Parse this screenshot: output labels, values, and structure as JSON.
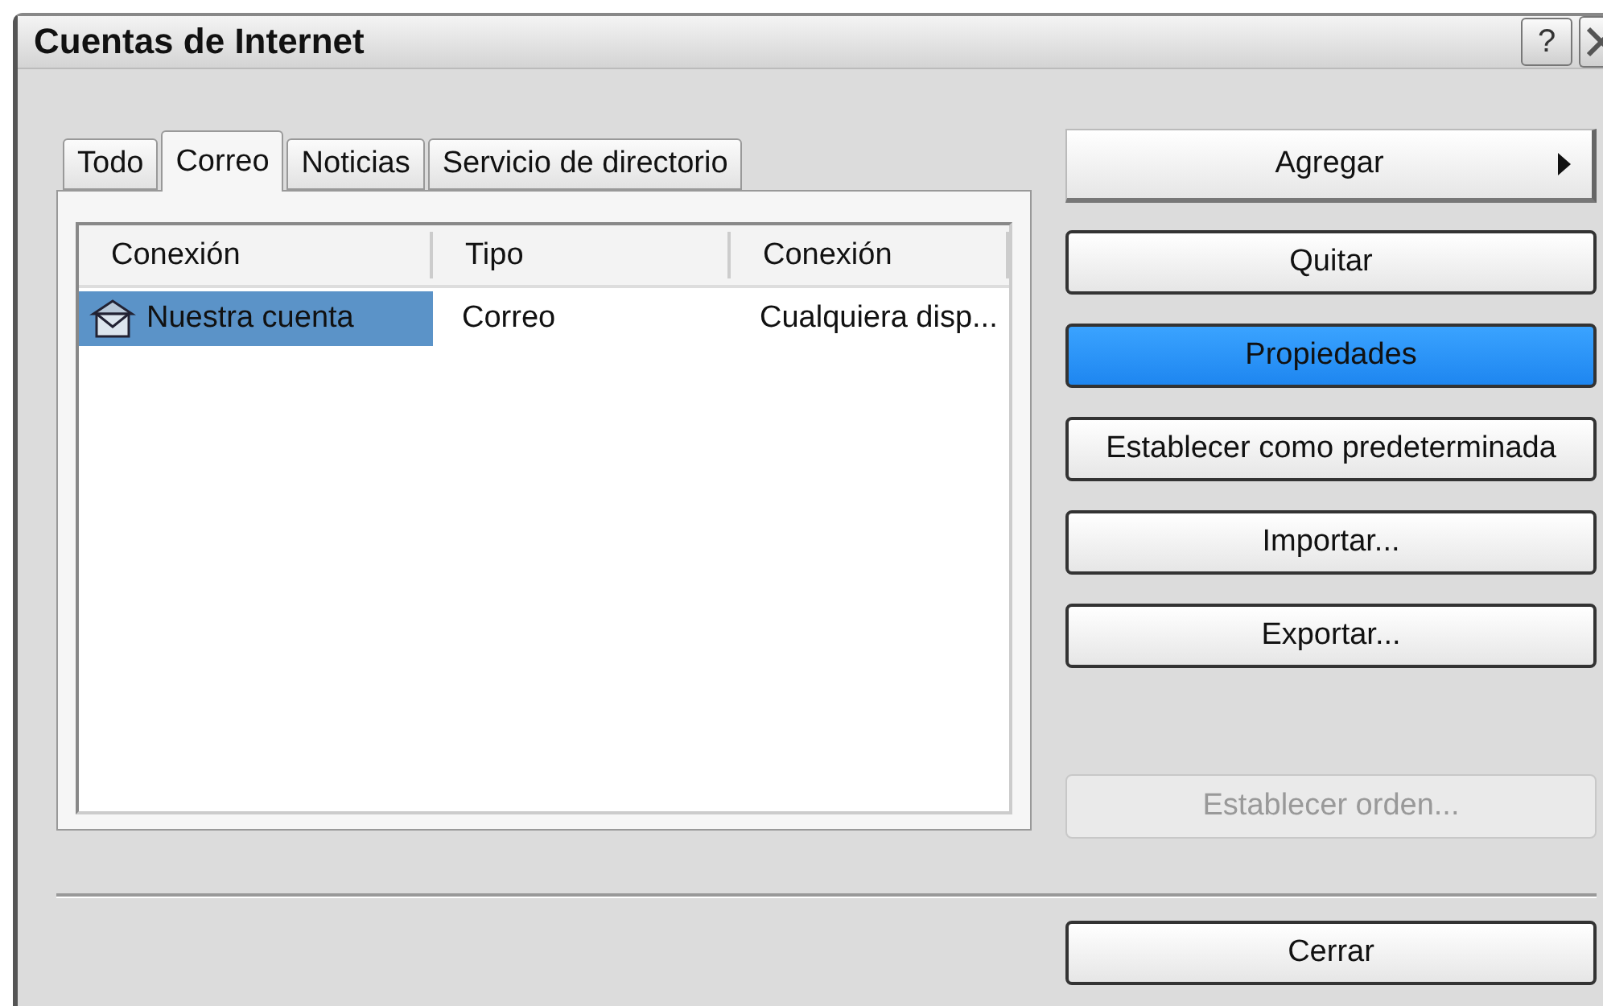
{
  "window": {
    "title": "Cuentas de Internet",
    "help_button": "?"
  },
  "tabs": [
    {
      "label": "Todo",
      "selected": false
    },
    {
      "label": "Correo",
      "selected": true
    },
    {
      "label": "Noticias",
      "selected": false
    },
    {
      "label": "Servicio de directorio",
      "selected": false
    }
  ],
  "table": {
    "columns": [
      "Conexión",
      "Tipo",
      "Conexión"
    ],
    "rows": [
      {
        "cells": [
          "Nuestra cuenta",
          "Correo",
          "Cualquiera disp..."
        ],
        "selected": true
      }
    ]
  },
  "buttons": [
    {
      "label": "Agregar",
      "kind": "menu",
      "highlighted": false,
      "disabled": false
    },
    {
      "label": "Quitar",
      "kind": "push",
      "highlighted": false,
      "disabled": false
    },
    {
      "label": "Propiedades",
      "kind": "push",
      "highlighted": true,
      "disabled": false
    },
    {
      "label": "Establecer como predeterminada",
      "kind": "push",
      "highlighted": false,
      "disabled": false
    },
    {
      "label": "Importar...",
      "kind": "push",
      "highlighted": false,
      "disabled": false
    },
    {
      "label": "Exportar...",
      "kind": "push",
      "highlighted": false,
      "disabled": false
    },
    {
      "label": "Establecer orden...",
      "kind": "push",
      "highlighted": false,
      "disabled": true
    }
  ],
  "footer_button": {
    "label": "Cerrar"
  }
}
